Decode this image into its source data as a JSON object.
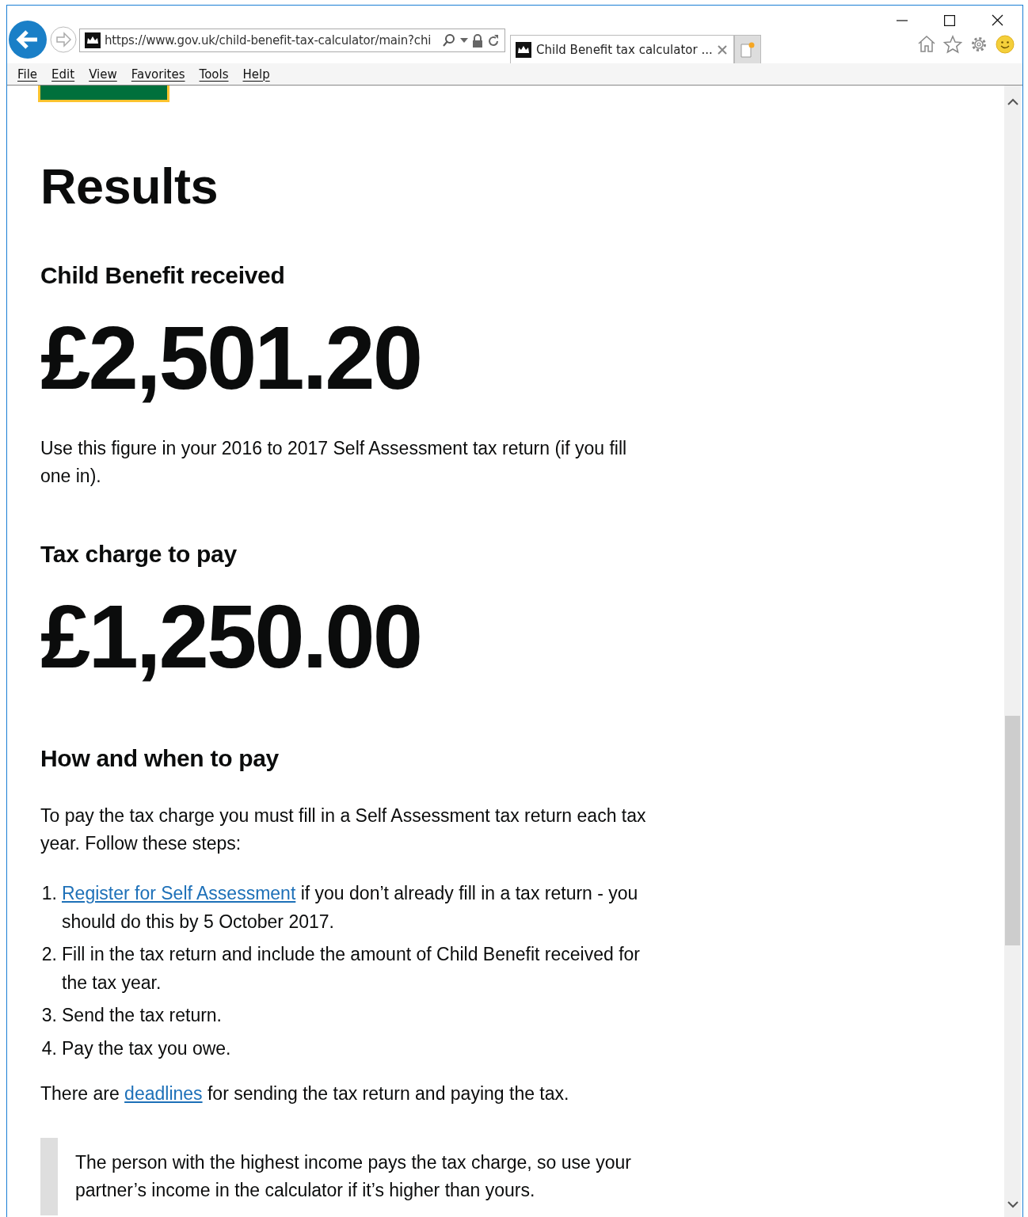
{
  "browser": {
    "address": "https://www.gov.uk/child-benefit-tax-calculator/main?chi",
    "tabs": [
      {
        "title": "Child Benefit tax calculator ...",
        "selected": true
      }
    ],
    "menu": [
      "File",
      "Edit",
      "View",
      "Favorites",
      "Tools",
      "Help"
    ]
  },
  "page": {
    "title": "Results",
    "sections": [
      {
        "kind": "amount",
        "heading": "Child Benefit received",
        "amount": "£2,501.20",
        "note": "Use this figure in your 2016 to 2017 Self Assessment tax return (if you fill one in)."
      },
      {
        "kind": "amount",
        "heading": "Tax charge to pay",
        "amount": "£1,250.00"
      },
      {
        "kind": "steps",
        "heading": "How and when to pay",
        "intro": "To pay the tax charge you must fill in a Self Assessment tax return each tax year. Follow these steps:",
        "steps": [
          {
            "number": "1.",
            "link": "Register for Self Assessment",
            "text": " if you don’t already fill in a tax return - you should do this by 5 October 2017."
          },
          {
            "number": "2.",
            "text": "Fill in the tax return and include the amount of Child Benefit received for the tax year."
          },
          {
            "number": "3.",
            "text": "Send the tax return."
          },
          {
            "number": "4.",
            "text": "Pay the tax you owe."
          }
        ],
        "after": {
          "before": "There are ",
          "link": "deadlines",
          "after": " for sending the tax return and paying the tax."
        },
        "inset": "The person with the highest income pays the tax charge, so use your partner’s income in the calculator if it’s higher than yours."
      }
    ]
  }
}
